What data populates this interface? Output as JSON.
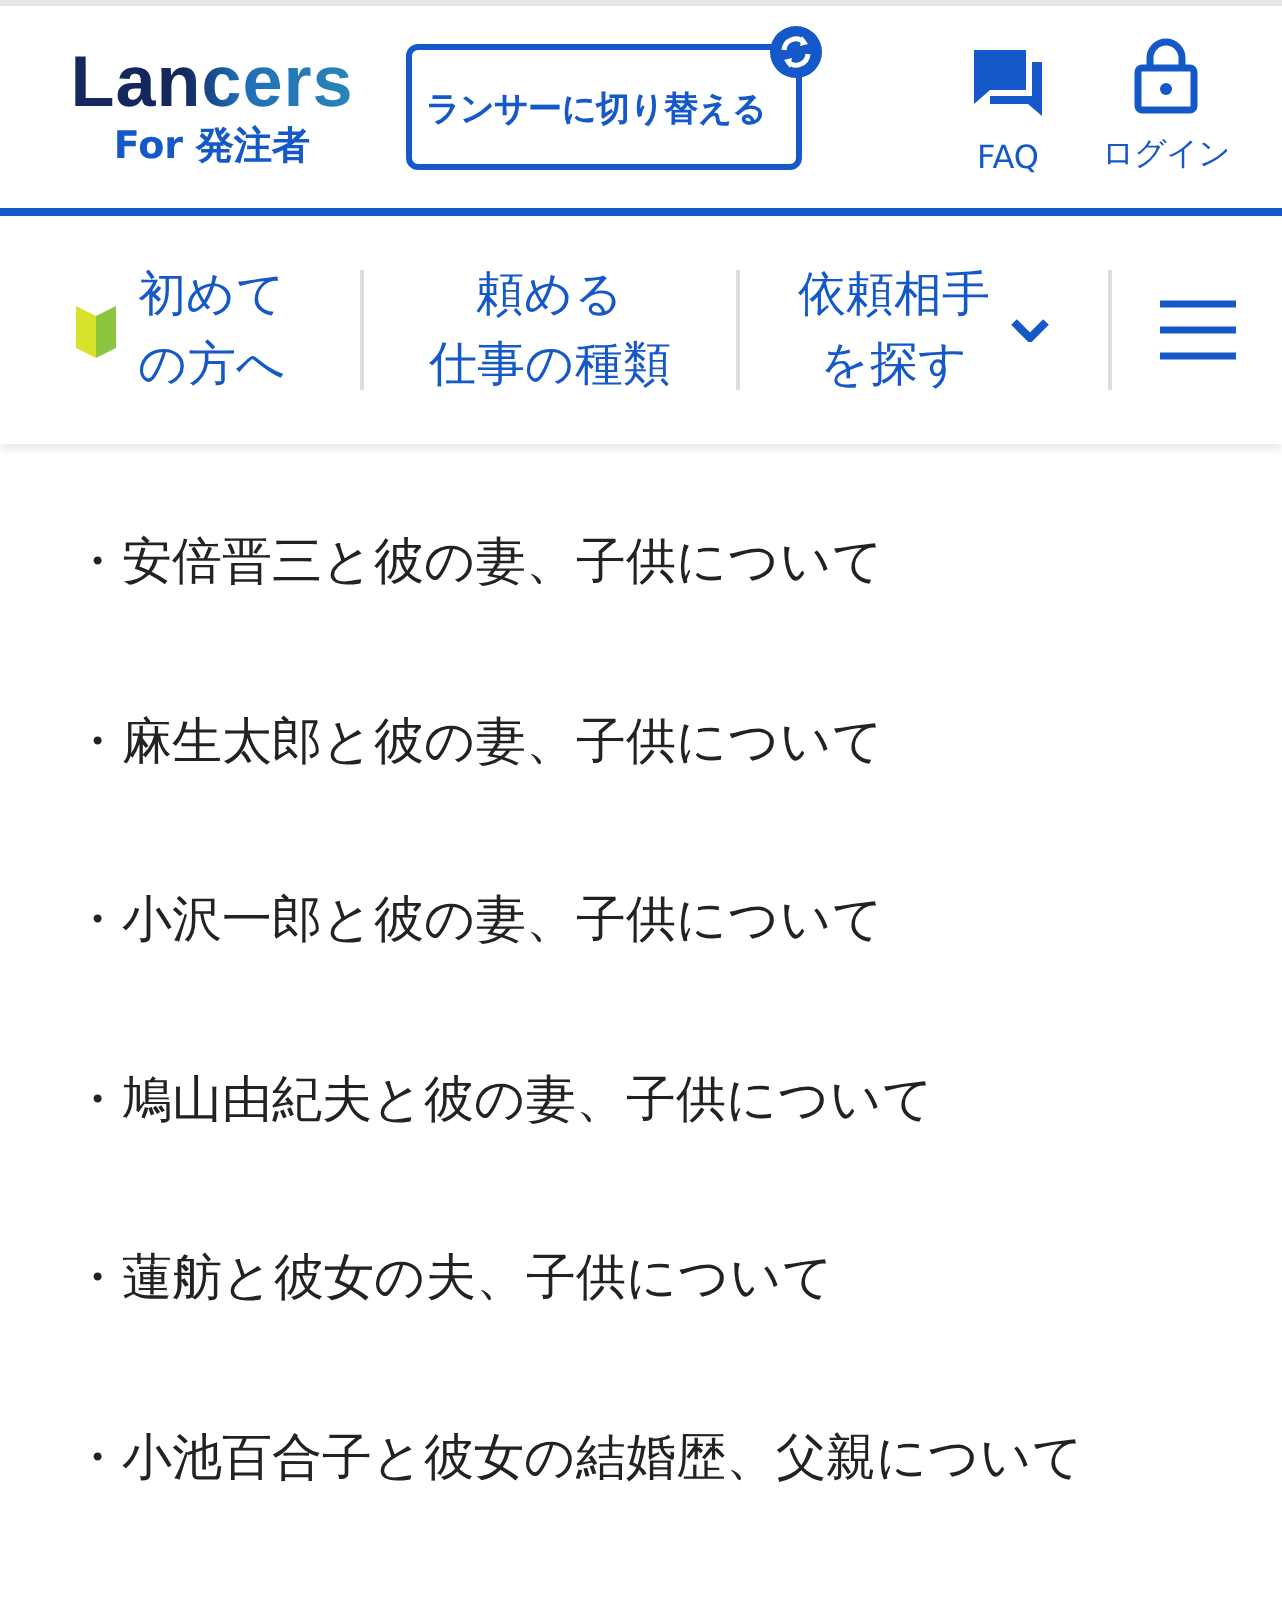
{
  "header": {
    "logo": "Lancers",
    "logo_sub": "For 発注者",
    "switch_button": "ランサーに切り替える",
    "actions": [
      {
        "kind": "faq",
        "label": "FAQ"
      },
      {
        "kind": "login",
        "label": "ログイン"
      }
    ]
  },
  "nav": {
    "items": [
      {
        "kind": "beginner",
        "lines": [
          "初めて",
          "の方へ"
        ]
      },
      {
        "kind": "plain",
        "lines": [
          "頼める",
          "仕事の種類"
        ]
      },
      {
        "kind": "dropdown",
        "lines": [
          "依頼相手",
          "を探す"
        ]
      }
    ]
  },
  "list": [
    "・安倍晋三と彼の妻、子供について",
    "・麻生太郎と彼の妻、子供について",
    "・小沢一郎と彼の妻、子供について",
    "・鳩山由紀夫と彼の妻、子供について",
    "・蓮舫と彼女の夫、子供について",
    "・小池百合子と彼女の結婚歴、父親について"
  ]
}
